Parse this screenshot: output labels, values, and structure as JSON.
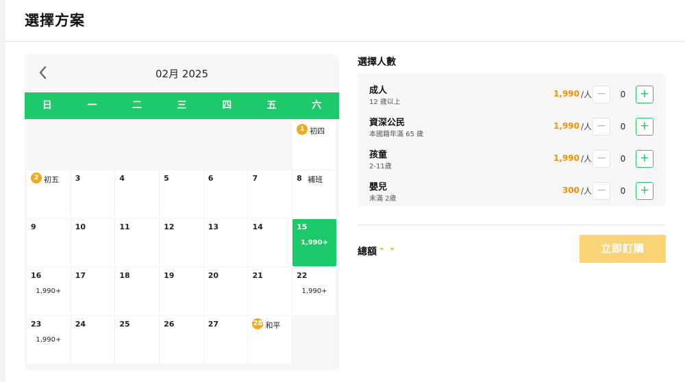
{
  "page": {
    "title": "選擇方案"
  },
  "calendar": {
    "month_label": "02月 2025",
    "weekdays": [
      "日",
      "一",
      "二",
      "三",
      "四",
      "五",
      "六"
    ],
    "weeks": [
      [
        null,
        null,
        null,
        null,
        null,
        null,
        {
          "day": "1",
          "badge": true,
          "note": "初四"
        }
      ],
      [
        {
          "day": "2",
          "badge": true,
          "note": "初五"
        },
        {
          "day": "3"
        },
        {
          "day": "4"
        },
        {
          "day": "5"
        },
        {
          "day": "6"
        },
        {
          "day": "7"
        },
        {
          "day": "8",
          "note": "補班"
        }
      ],
      [
        {
          "day": "9"
        },
        {
          "day": "10"
        },
        {
          "day": "11"
        },
        {
          "day": "12"
        },
        {
          "day": "13"
        },
        {
          "day": "14"
        },
        {
          "day": "15",
          "price": "1,990+",
          "selected": true
        }
      ],
      [
        {
          "day": "16",
          "price": "1,990+"
        },
        {
          "day": "17"
        },
        {
          "day": "18"
        },
        {
          "day": "19"
        },
        {
          "day": "20"
        },
        {
          "day": "21"
        },
        {
          "day": "22",
          "price": "1,990+"
        }
      ],
      [
        {
          "day": "23",
          "price": "1,990+"
        },
        {
          "day": "24"
        },
        {
          "day": "25"
        },
        {
          "day": "26"
        },
        {
          "day": "27"
        },
        {
          "day": "28",
          "badge": true,
          "note": "和平"
        },
        null
      ]
    ]
  },
  "people": {
    "title": "選擇人數",
    "unit": "/人",
    "rows": [
      {
        "name": "成人",
        "desc": "12 歲以上",
        "price": "1,990",
        "qty": "0"
      },
      {
        "name": "資深公民",
        "desc": "本國籍年滿 65 歲",
        "price": "1,990",
        "qty": "0"
      },
      {
        "name": "孩童",
        "desc": "2-11歲",
        "price": "1,990",
        "qty": "0"
      },
      {
        "name": "嬰兒",
        "desc": "未滿 2歲",
        "price": "300",
        "qty": "0"
      }
    ],
    "minus_symbol": "−",
    "plus_symbol": "+"
  },
  "summary": {
    "total_label": "總額",
    "total_value": "- -",
    "book_label": "立即訂購"
  },
  "colors": {
    "accent_green": "#1ec969",
    "price_orange": "#f29100",
    "badge_orange": "#f2a81b",
    "book_button": "#fcd277"
  }
}
